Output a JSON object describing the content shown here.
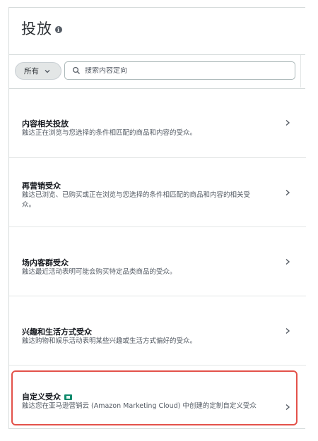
{
  "header": {
    "title": "投放",
    "info_icon": "info-icon"
  },
  "filter": {
    "selected": "所有",
    "icon": "chevron-down-icon"
  },
  "search": {
    "placeholder": "搜索内容定向",
    "icon": "search-icon"
  },
  "items": [
    {
      "title": "内容相关投放",
      "description": "触达正在浏览与您选择的条件相匹配的商品和内容的受众。"
    },
    {
      "title": "再营销受众",
      "description": "触达已浏览、已购买或正在浏览与您选择的条件相匹配的商品和内容的相关受众。"
    },
    {
      "title": "场内客群受众",
      "description": "触达最近活动表明可能会购买特定品类商品的受众。"
    },
    {
      "title": "兴趣和生活方式受众",
      "description": "触达购物和娱乐活动表明某些兴趣或生活方式偏好的受众。"
    },
    {
      "title": "自定义受众",
      "description": "触达您在亚马逊营销云 (Amazon Marketing Cloud) 中创建的定制自定义受众",
      "badge_icon": "amc-badge-icon",
      "highlighted": true
    }
  ],
  "colors": {
    "highlight_border": "#e3524a",
    "badge": "#0f8a6c"
  }
}
